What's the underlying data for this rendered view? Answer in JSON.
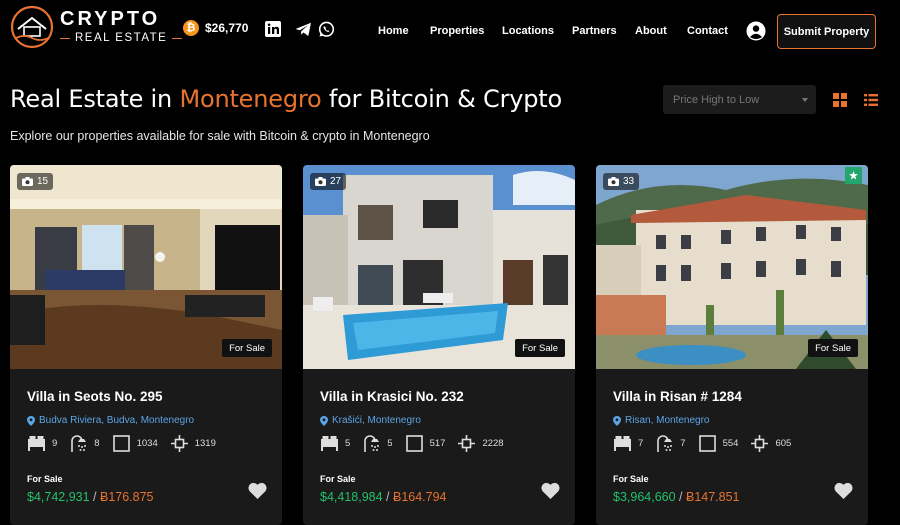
{
  "brand": {
    "name": "CRYPTO",
    "sub": "REAL ESTATE"
  },
  "btc_price": "$26,770",
  "nav": [
    "Home",
    "Properties",
    "Locations",
    "Partners",
    "About",
    "Contact"
  ],
  "submit_label": "Submit Property",
  "heading": {
    "pre": "Real Estate in ",
    "highlight": "Montenegro",
    "post": " for Bitcoin & Crypto"
  },
  "subtitle": "Explore our properties available for sale with Bitcoin & crypto in Montenegro",
  "sort": {
    "selected": "Price High to Low"
  },
  "colors": {
    "accent": "#e8732f",
    "price_green": "#23c06a",
    "location_blue": "#5aa5e6",
    "featured_green": "#23a56c"
  },
  "icons": [
    "bitcoin-icon",
    "linkedin-icon",
    "telegram-icon",
    "whatsapp-icon",
    "user-icon",
    "grid-view-icon",
    "list-view-icon",
    "camera-icon",
    "star-icon",
    "map-pin-icon",
    "bed-icon",
    "shower-icon",
    "area-icon",
    "plot-icon",
    "heart-icon"
  ],
  "cards": [
    {
      "photos": "15",
      "badge": "For Sale",
      "title": "Villa in Seots No. 295",
      "location": "Budva Riviera, Budva, Montenegro",
      "beds": "9",
      "baths": "8",
      "area": "1034",
      "plot": "1319",
      "status": "For Sale",
      "price_usd": "$4,742,931",
      "sep": " / ",
      "price_btc": "Ƀ176.875",
      "featured": false
    },
    {
      "photos": "27",
      "badge": "For Sale",
      "title": "Villa in Krasici No. 232",
      "location": "Krašići, Montenegro",
      "beds": "5",
      "baths": "5",
      "area": "517",
      "plot": "2228",
      "status": "For Sale",
      "price_usd": "$4,418,984",
      "sep": " / ",
      "price_btc": "Ƀ164.794",
      "featured": false
    },
    {
      "photos": "33",
      "badge": "For Sale",
      "title": "Villa in Risan # 1284",
      "location": "Risan, Montenegro",
      "beds": "7",
      "baths": "7",
      "area": "554",
      "plot": "605",
      "status": "For Sale",
      "price_usd": "$3,964,660",
      "sep": " / ",
      "price_btc": "Ƀ147.851",
      "featured": true
    }
  ]
}
